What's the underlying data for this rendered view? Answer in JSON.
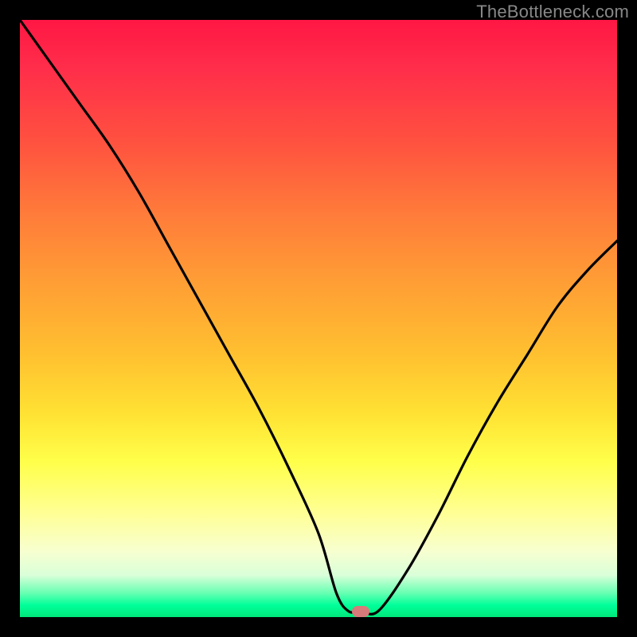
{
  "watermark": "TheBottleneck.com",
  "chart_data": {
    "type": "line",
    "title": "",
    "xlabel": "",
    "ylabel": "",
    "xlim": [
      0,
      100
    ],
    "ylim": [
      0,
      100
    ],
    "grid": false,
    "series": [
      {
        "name": "bottleneck-curve",
        "x": [
          0,
          5,
          10,
          15,
          20,
          25,
          30,
          35,
          40,
          45,
          50,
          53,
          55,
          57,
          60,
          65,
          70,
          75,
          80,
          85,
          90,
          95,
          100
        ],
        "y": [
          100,
          93,
          86,
          79,
          71,
          62,
          53,
          44,
          35,
          25,
          14,
          4,
          1,
          1,
          1,
          8,
          17,
          27,
          36,
          44,
          52,
          58,
          63
        ]
      }
    ],
    "annotations": [
      {
        "name": "optimal-marker",
        "x": 57,
        "y": 1
      }
    ],
    "background_gradient": {
      "top": "#ff1744",
      "mid": "#ffe233",
      "bottom": "#00e67a",
      "meaning": "high-to-low bottleneck"
    }
  }
}
